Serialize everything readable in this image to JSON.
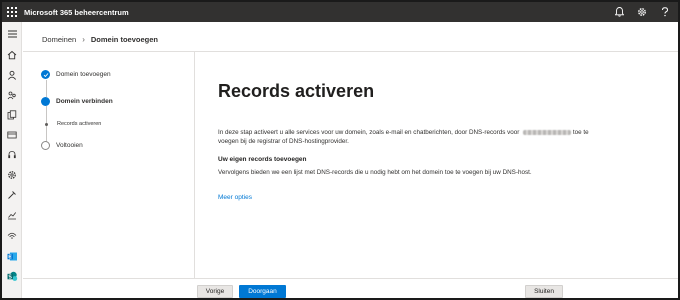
{
  "topbar": {
    "app_title": "Microsoft 365 beheercentrum",
    "icons": [
      "waffle-icon",
      "bell-icon",
      "gear-icon",
      "help-icon"
    ]
  },
  "rail": {
    "icons": [
      "menu-icon",
      "home-icon",
      "user-icon",
      "groups-icon",
      "copy-icon",
      "billing-icon",
      "support-icon",
      "settings-icon",
      "setup-icon",
      "reports-icon",
      "health-icon",
      "exchange-icon",
      "sharepoint-icon"
    ]
  },
  "breadcrumb": {
    "parent": "Domeinen",
    "current": "Domein toevoegen"
  },
  "steps": {
    "step1": "Domein toevoegen",
    "step2": "Domein verbinden",
    "substep": "Records activeren",
    "step3": "Voltooien"
  },
  "content": {
    "heading": "Records activeren",
    "para1_before": "In deze stap activeert u alle services voor uw domein, zoals e-mail en chatberichten, door DNS-records voor",
    "para1_after": "toe te voegen bij de registrar of DNS-hostingprovider.",
    "subheading": "Uw eigen records toevoegen",
    "para2": "Vervolgens bieden we een lijst met DNS-records die u nodig hebt om het domein toe te voegen bij uw DNS-host.",
    "more_options": "Meer opties"
  },
  "footer": {
    "back_label": "Vorige",
    "next_label": "Doorgaan",
    "close_label": "Sluiten"
  },
  "colors": {
    "accent": "#0078d4",
    "topbar": "#323130",
    "rail": "#f3f2f1"
  }
}
